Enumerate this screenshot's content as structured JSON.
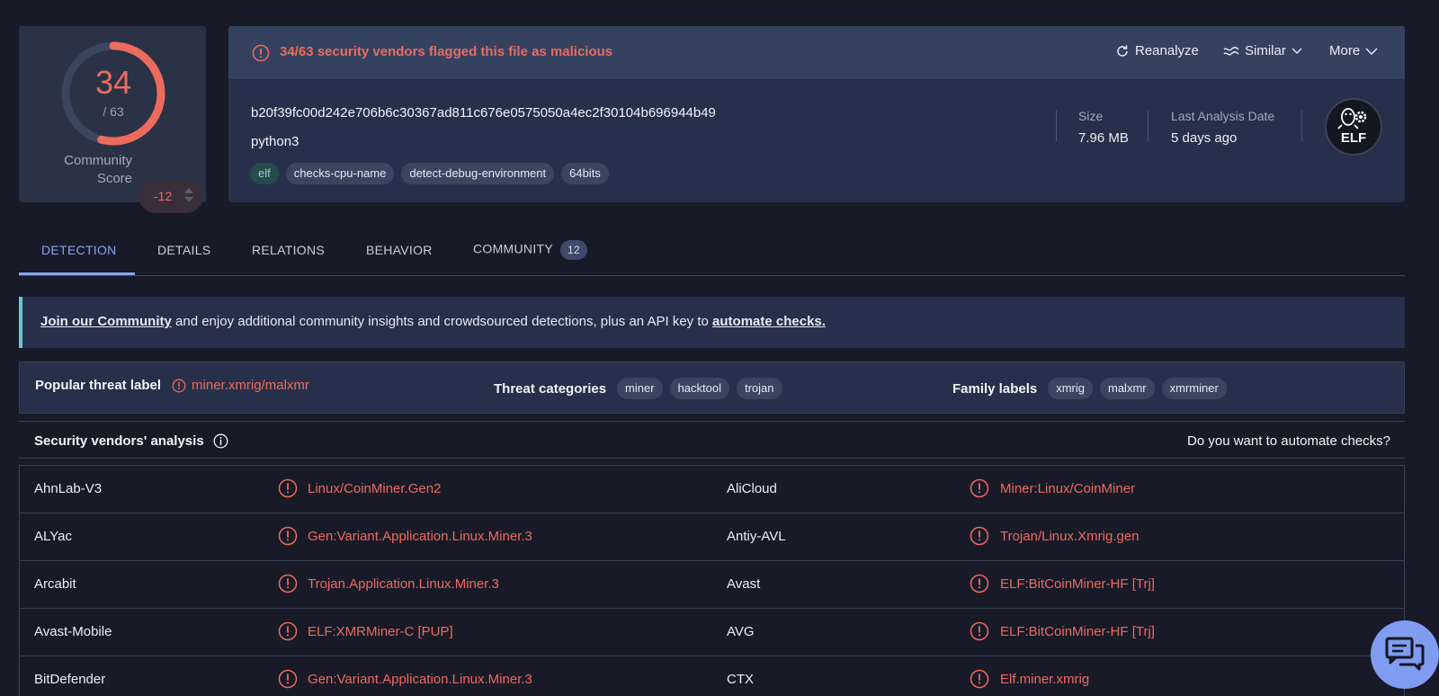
{
  "score": {
    "detections": "34",
    "total": "/ 63",
    "ratio": 0.54,
    "community_label_line1": "Community",
    "community_label_line2": "Score",
    "community_value": "-12"
  },
  "file": {
    "alert": "34/63 security vendors flagged this file as malicious",
    "actions": {
      "reanalyze": "Reanalyze",
      "similar": "Similar",
      "more": "More"
    },
    "hash": "b20f39fc00d242e706b6c30367ad811c676e0575050a4ec2f30104b696944b49",
    "name": "python3",
    "tags": [
      "elf",
      "checks-cpu-name",
      "detect-debug-environment",
      "64bits"
    ],
    "size_label": "Size",
    "size_value": "7.96 MB",
    "date_label": "Last Analysis Date",
    "date_value": "5 days ago",
    "type_badge": "ELF"
  },
  "tabs": {
    "detection": "DETECTION",
    "details": "DETAILS",
    "relations": "RELATIONS",
    "behavior": "BEHAVIOR",
    "community": "COMMUNITY",
    "community_count": "12"
  },
  "banner": {
    "link1": "Join our Community",
    "middle": " and enjoy additional community insights and crowdsourced detections, plus an API key to ",
    "link2": "automate checks."
  },
  "threat": {
    "popular_title": "Popular threat label",
    "popular_value": "miner.xmrig/malxmr",
    "categories_title": "Threat categories",
    "categories": [
      "miner",
      "hacktool",
      "trojan"
    ],
    "family_title": "Family labels",
    "families": [
      "xmrig",
      "malxmr",
      "xmrminer"
    ]
  },
  "vendors": {
    "title": "Security vendors' analysis",
    "automate": "Do you want to automate checks?",
    "rows": [
      {
        "left_name": "AhnLab-V3",
        "left_result": "Linux/CoinMiner.Gen2",
        "right_name": "AliCloud",
        "right_result": "Miner:Linux/CoinMiner"
      },
      {
        "left_name": "ALYac",
        "left_result": "Gen:Variant.Application.Linux.Miner.3",
        "right_name": "Antiy-AVL",
        "right_result": "Trojan/Linux.Xmrig.gen"
      },
      {
        "left_name": "Arcabit",
        "left_result": "Trojan.Application.Linux.Miner.3",
        "right_name": "Avast",
        "right_result": "ELF:BitCoinMiner-HF [Trj]"
      },
      {
        "left_name": "Avast-Mobile",
        "left_result": "ELF:XMRMiner-C [PUP]",
        "right_name": "AVG",
        "right_result": "ELF:BitCoinMiner-HF [Trj]"
      },
      {
        "left_name": "BitDefender",
        "left_result": "Gen:Variant.Application.Linux.Miner.3",
        "right_name": "CTX",
        "right_result": "Elf.miner.xmrig"
      }
    ]
  },
  "colors": {
    "accent_red": "#ec6b5d",
    "accent_blue": "#8aa3ef",
    "background": "#181a28"
  }
}
